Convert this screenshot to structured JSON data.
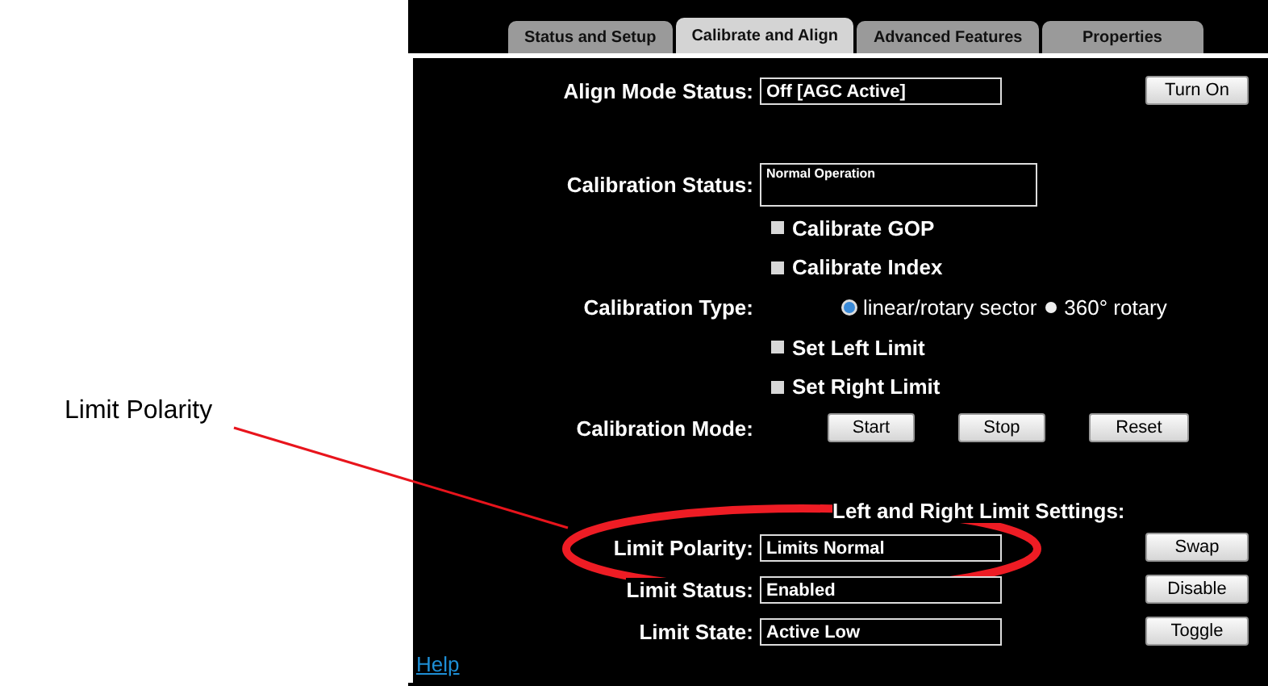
{
  "tabs": [
    {
      "label": "Status and Setup",
      "selected": false
    },
    {
      "label": "Calibrate and Align",
      "selected": true
    },
    {
      "label": "Advanced Features",
      "selected": false
    },
    {
      "label": "Properties",
      "selected": false
    }
  ],
  "rows": [
    {
      "kind": "field",
      "label": "Align Mode Status:",
      "value": "Off [AGC Active]",
      "button": "Turn On"
    },
    {
      "kind": "status",
      "label": "Calibration Status:",
      "value": "Normal Operation"
    },
    {
      "kind": "checkbox",
      "label": "Calibrate GOP",
      "checked": false
    },
    {
      "kind": "checkbox",
      "label": "Calibrate Index",
      "checked": false
    },
    {
      "kind": "radio",
      "label": "Calibration Type:",
      "options": [
        {
          "label": "linear/rotary sector",
          "selected": true
        },
        {
          "label": "360° rotary",
          "selected": false
        }
      ]
    },
    {
      "kind": "checkbox",
      "label": "Set Left Limit",
      "checked": false
    },
    {
      "kind": "checkbox",
      "label": "Set Right Limit",
      "checked": false
    },
    {
      "kind": "buttons",
      "label": "Calibration Mode:",
      "buttons": [
        "Start",
        "Stop",
        "Reset"
      ]
    },
    {
      "kind": "heading",
      "label": "Left and Right Limit Settings:"
    },
    {
      "kind": "field",
      "label": "Limit Polarity:",
      "value": "Limits Normal",
      "button": "Swap",
      "highlighted": true
    },
    {
      "kind": "field",
      "label": "Limit Status:",
      "value": "Enabled",
      "button": "Disable"
    },
    {
      "kind": "field",
      "label": "Limit State:",
      "value": "Active Low",
      "button": "Toggle"
    }
  ],
  "help_link": "Help",
  "callout": {
    "label": "Limit Polarity"
  }
}
